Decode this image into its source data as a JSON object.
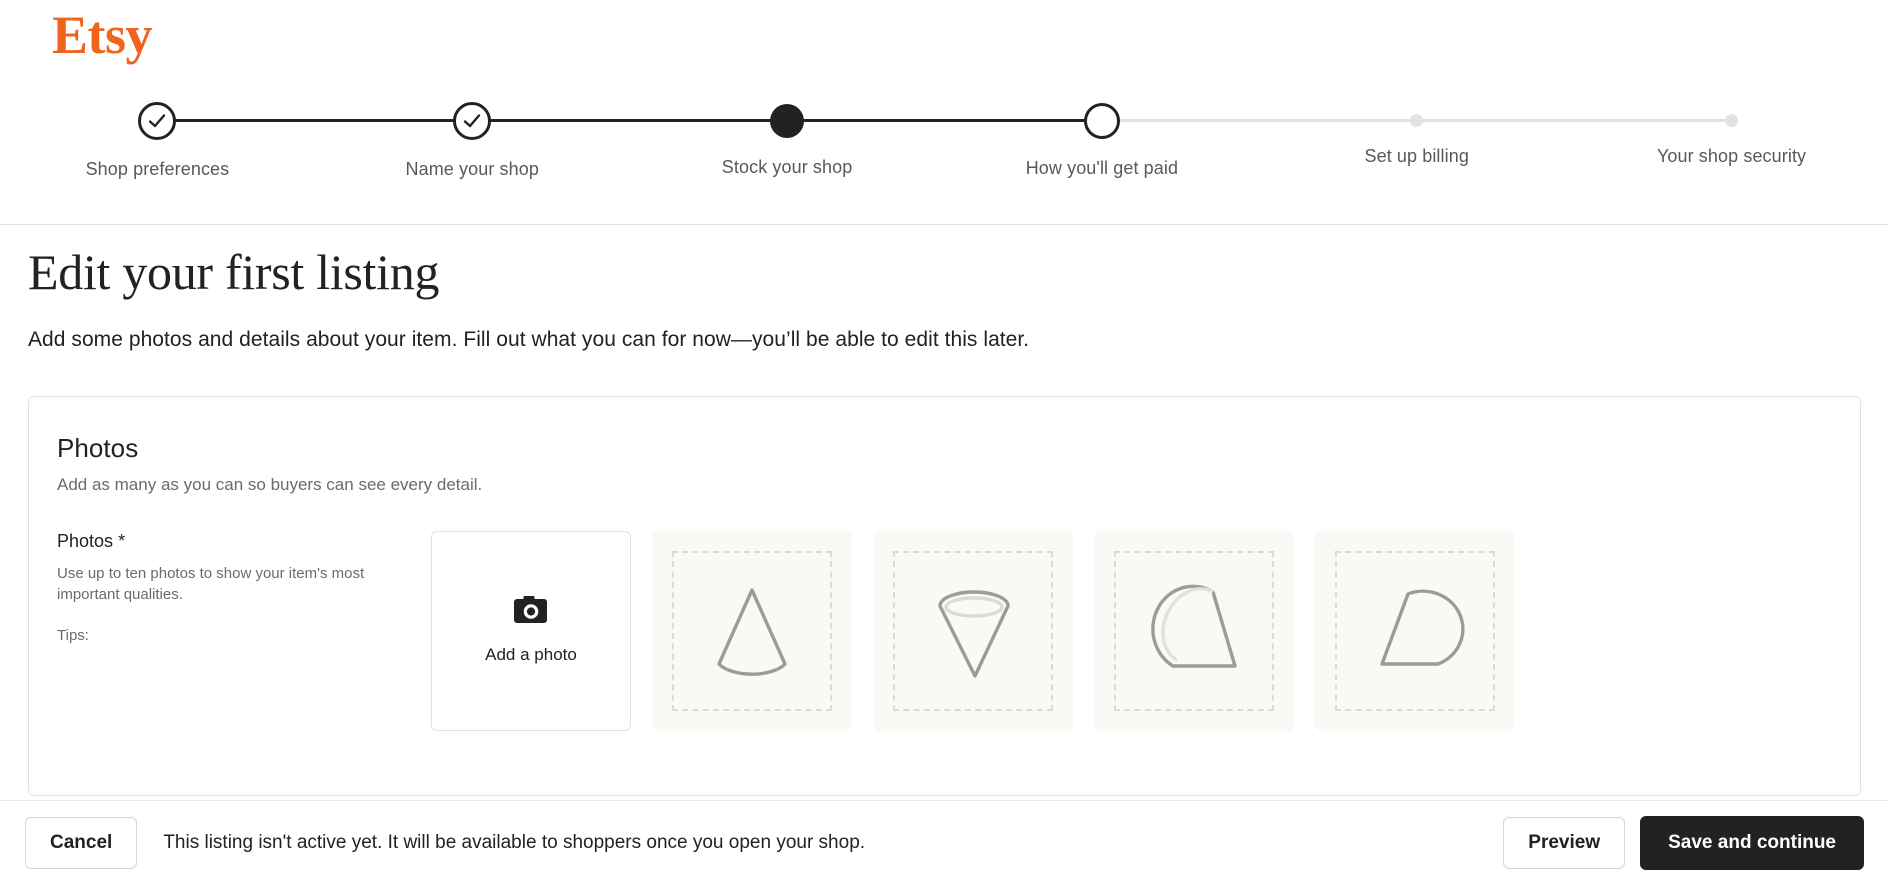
{
  "brand": {
    "name": "Etsy",
    "color": "#F1641E"
  },
  "stepper": {
    "steps": [
      {
        "label": "Shop preferences",
        "state": "done",
        "icon": "check-icon"
      },
      {
        "label": "Name your shop",
        "state": "done",
        "icon": "check-icon"
      },
      {
        "label": "Stock your shop",
        "state": "current",
        "icon": "filled-dot-icon"
      },
      {
        "label": "How you'll get paid",
        "state": "next",
        "icon": "empty-circle-icon"
      },
      {
        "label": "Set up billing",
        "state": "todo",
        "icon": "small-dot-icon"
      },
      {
        "label": "Your shop security",
        "state": "todo",
        "icon": "small-dot-icon"
      }
    ]
  },
  "page": {
    "title": "Edit your first listing",
    "subtitle": "Add some photos and details about your item. Fill out what you can for now—you’ll be able to edit this later."
  },
  "photos_card": {
    "title": "Photos",
    "subtitle": "Add as many as you can so buyers can see every detail.",
    "field_label": "Photos",
    "required_mark": "*",
    "field_help": "Use up to ten photos to show your item's most important qualities.",
    "tips_label": "Tips:",
    "add_photo_label": "Add a photo",
    "add_photo_icon": "camera-icon",
    "slots": [
      {
        "type": "add"
      },
      {
        "type": "empty",
        "shape": "cone-upright"
      },
      {
        "type": "empty",
        "shape": "cone-inverted"
      },
      {
        "type": "empty",
        "shape": "cone-tilted-left"
      },
      {
        "type": "empty",
        "shape": "cone-tilted-right"
      }
    ]
  },
  "bottom_bar": {
    "cancel_label": "Cancel",
    "note": "This listing isn't active yet. It will be available to shoppers once you open your shop.",
    "preview_label": "Preview",
    "save_label": "Save and continue"
  }
}
